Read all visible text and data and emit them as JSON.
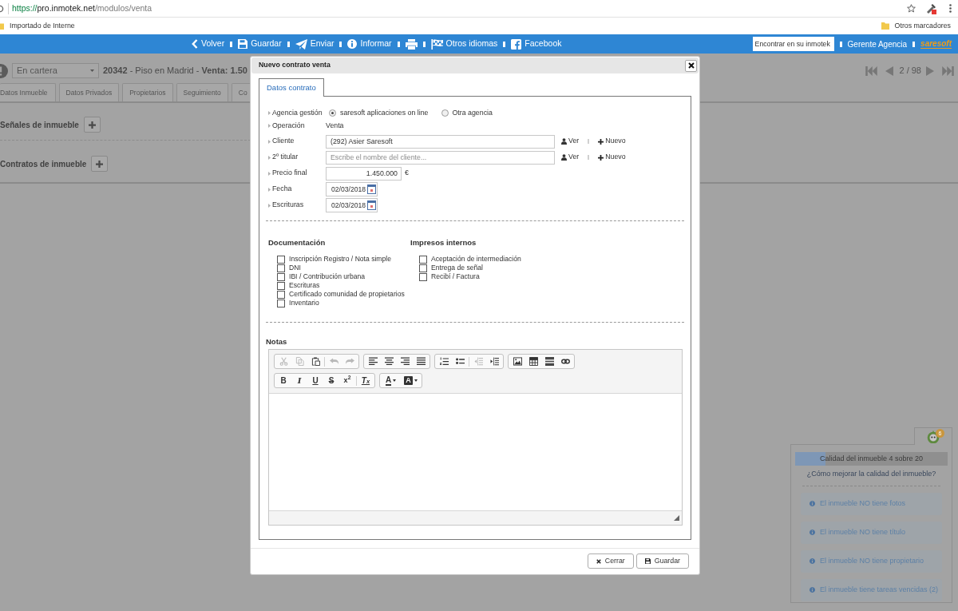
{
  "browser": {
    "url": {
      "scheme": "https://",
      "host": "pro.inmotek.net",
      "path": "/modulos/venta"
    },
    "bookmarks": [
      {
        "label": "Importado de Interne"
      }
    ],
    "other_bookmarks": "Otros marcadores"
  },
  "toolbar": {
    "items": [
      {
        "kind": "back",
        "label": "Volver"
      },
      {
        "kind": "save",
        "label": "Guardar"
      },
      {
        "kind": "send",
        "label": "Enviar"
      },
      {
        "kind": "report",
        "label": "Informar"
      },
      {
        "kind": "print"
      },
      {
        "kind": "languages",
        "label": "Otros idiomas"
      },
      {
        "kind": "social",
        "label": "Facebook"
      }
    ],
    "search": {
      "placeholder": "Encontrar en su inmotek"
    },
    "user": "Gerente Agencia",
    "logo": "saresoft"
  },
  "page": {
    "status_select": "En cartera",
    "heading": "**20342** - Piso en Madrid - **Venta: 1.50**",
    "pagination": "2 / 98",
    "tabs": [
      {
        "label": "Datos Inmueble",
        "selected": false
      },
      {
        "label": "Datos Privados",
        "selected": false
      },
      {
        "label": "Propietarios",
        "selected": false
      },
      {
        "label": "Seguimiento",
        "selected": false
      },
      {
        "label": "Co",
        "selected": false
      }
    ],
    "sections": [
      {
        "title": "Señales de inmueble"
      },
      {
        "title": "Contratos de inmueble"
      }
    ]
  },
  "quality": {
    "badge": "6",
    "title": "Calidad del inmueble 4 sobre 20",
    "level": 0.2,
    "link": "¿Cómo mejorar la calidad del inmueble?",
    "tips": [
      "El inmueble NO tiene fotos",
      "El inmueble NO tiene título",
      "El inmueble NO tiene propietario",
      "El inmueble tiene tareas vencidas (2)"
    ]
  },
  "dialog": {
    "title": "Nuevo contrato venta",
    "tabs": [
      {
        "label": "Datos contrato",
        "selected": true
      }
    ],
    "fields": [
      {
        "kind": "radio",
        "label": "Agencia gestión",
        "options": [
          {
            "label": "saresoft aplicaciones on line",
            "selected": true
          },
          {
            "label": "Otra agencia",
            "selected": false
          }
        ]
      },
      {
        "kind": "static",
        "label": "Operación",
        "value": "Venta"
      },
      {
        "kind": "lookup",
        "label": "Cliente",
        "value": "(292) Asier Saresoft",
        "actions": [
          {
            "kind": "view",
            "label": "Ver"
          },
          {
            "kind": "new",
            "label": "Nuevo"
          }
        ]
      },
      {
        "kind": "lookup",
        "label": "2º titular",
        "placeholder": "Escribe el nombre del cliente...",
        "actions": [
          {
            "kind": "view",
            "label": "Ver"
          },
          {
            "kind": "new",
            "label": "Nuevo"
          }
        ]
      },
      {
        "kind": "amount",
        "label": "Precio final",
        "value": "1.450.000",
        "unit": "€"
      },
      {
        "kind": "date",
        "label": "Fecha",
        "value": "02/03/2018"
      },
      {
        "kind": "date",
        "label": "Escrituras",
        "value": "02/03/2018"
      }
    ],
    "checklists": [
      {
        "title": "Documentación",
        "items": [
          {
            "label": "Inscripción Registro / Nota simple",
            "checked": false
          },
          {
            "label": "DNI",
            "checked": false
          },
          {
            "label": "IBI / Contribución urbana",
            "checked": false
          },
          {
            "label": "Escrituras",
            "checked": false
          },
          {
            "label": "Certificado comunidad de propietarios",
            "checked": false
          },
          {
            "label": "Inventario",
            "checked": false
          }
        ]
      },
      {
        "title": "Impresos internos",
        "items": [
          {
            "label": "Aceptación de intermediación",
            "checked": false
          },
          {
            "label": "Entrega de señal",
            "checked": false
          },
          {
            "label": "Recibí / Factura",
            "checked": false
          }
        ]
      }
    ],
    "notes": {
      "label": "Notas",
      "toolbar_rows": [
        {
          "groups": [
            {
              "parts": [
                [
                  {
                    "kind": "cut",
                    "disabled": true
                  },
                  {
                    "kind": "copy",
                    "disabled": true
                  },
                  {
                    "kind": "paste",
                    "disabled": false
                  }
                ],
                [
                  {
                    "kind": "undo",
                    "disabled": true
                  },
                  {
                    "kind": "redo",
                    "disabled": true
                  }
                ]
              ]
            },
            {
              "parts": [
                [
                  {
                    "kind": "align_left",
                    "disabled": false
                  },
                  {
                    "kind": "align_center",
                    "disabled": false
                  },
                  {
                    "kind": "align_right",
                    "disabled": false
                  },
                  {
                    "kind": "justify",
                    "disabled": false
                  }
                ]
              ]
            },
            {
              "parts": [
                [
                  {
                    "kind": "numbered_list",
                    "disabled": false
                  },
                  {
                    "kind": "bulleted_list",
                    "disabled": false
                  }
                ],
                [
                  {
                    "kind": "outdent",
                    "disabled": true
                  },
                  {
                    "kind": "indent",
                    "disabled": false
                  }
                ]
              ]
            },
            {
              "parts": [
                [
                  {
                    "kind": "image",
                    "disabled": false
                  },
                  {
                    "kind": "table",
                    "disabled": false
                  },
                  {
                    "kind": "horizontal_rule",
                    "disabled": false
                  },
                  {
                    "kind": "link",
                    "disabled": false
                  }
                ]
              ]
            }
          ]
        },
        {
          "groups": [
            {
              "parts": [
                [
                  {
                    "kind": "bold",
                    "label": "B",
                    "disabled": false
                  },
                  {
                    "kind": "italic",
                    "label": "I",
                    "disabled": false
                  },
                  {
                    "kind": "underline",
                    "label": "U",
                    "disabled": false
                  },
                  {
                    "kind": "strike",
                    "label": "S",
                    "disabled": false
                  },
                  {
                    "kind": "superscript",
                    "label": "x$^{2}$",
                    "disabled": false
                  }
                ],
                [
                  {
                    "kind": "remove_format",
                    "label": "T$_{x}$",
                    "disabled": false
                  }
                ]
              ]
            },
            {
              "parts": [
                [
                  {
                    "kind": "text_color",
                    "label": "A",
                    "disabled": false
                  },
                  {
                    "kind": "background_color",
                    "label": "A",
                    "disabled": false
                  }
                ]
              ]
            }
          ]
        }
      ]
    },
    "buttons": [
      {
        "kind": "close",
        "label": "Cerrar"
      },
      {
        "kind": "save",
        "label": "Guardar"
      }
    ]
  }
}
